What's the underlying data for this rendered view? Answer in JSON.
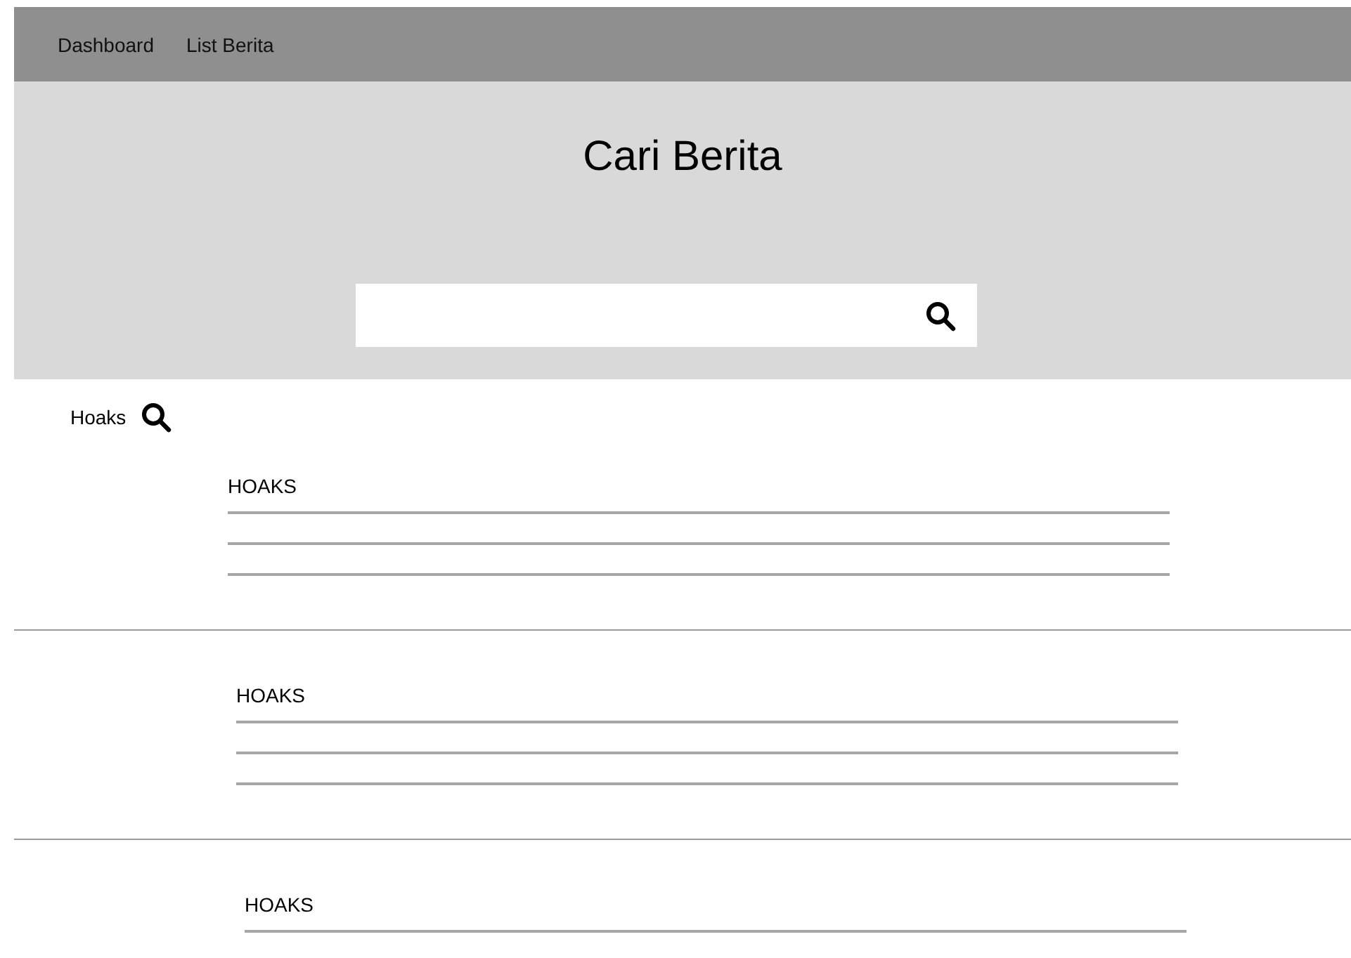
{
  "nav": {
    "items": [
      {
        "label": "Dashboard"
      },
      {
        "label": "List Berita"
      }
    ]
  },
  "header": {
    "title": "Cari Berita"
  },
  "query": {
    "label": "Hoaks"
  },
  "results": [
    {
      "title": "HOAKS"
    },
    {
      "title": "HOAKS"
    },
    {
      "title": "HOAKS"
    }
  ]
}
